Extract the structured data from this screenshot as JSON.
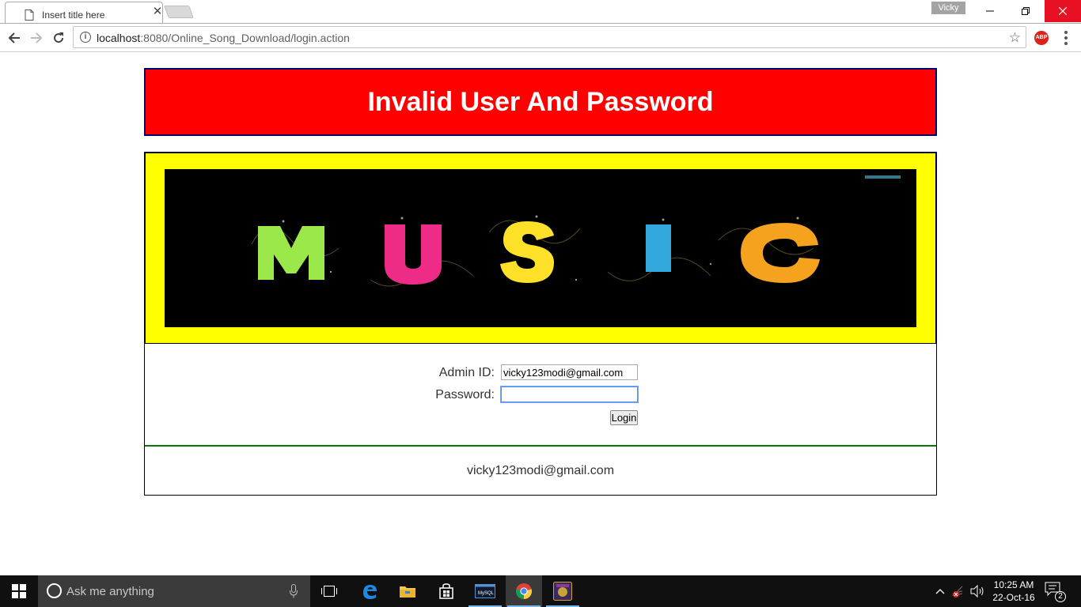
{
  "browser": {
    "tab_title": "Insert title here",
    "profile_name": "Vicky",
    "url_host": "localhost",
    "url_path": ":8080/Online_Song_Download/login.action",
    "extension": "ABP"
  },
  "page": {
    "error_message": "Invalid User And Password",
    "banner_image": "music-banner",
    "form": {
      "admin_id_label": "Admin ID:",
      "admin_id_value": "vicky123modi@gmail.com",
      "password_label": "Password:",
      "password_value": "",
      "login_button": "Login"
    },
    "footer_email": "vicky123modi@gmail.com",
    "colors": {
      "error_bg": "#ff0000",
      "banner_frame": "#ffff00",
      "footer_divider": "#007a00"
    }
  },
  "taskbar": {
    "search_placeholder": "Ask me anything",
    "time": "10:25 AM",
    "date": "22-Oct-16",
    "notification_count": "2",
    "apps": [
      "task-view-icon",
      "edge-icon",
      "file-explorer-icon",
      "store-icon",
      "mysql-icon",
      "chrome-icon",
      "game-icon"
    ]
  }
}
